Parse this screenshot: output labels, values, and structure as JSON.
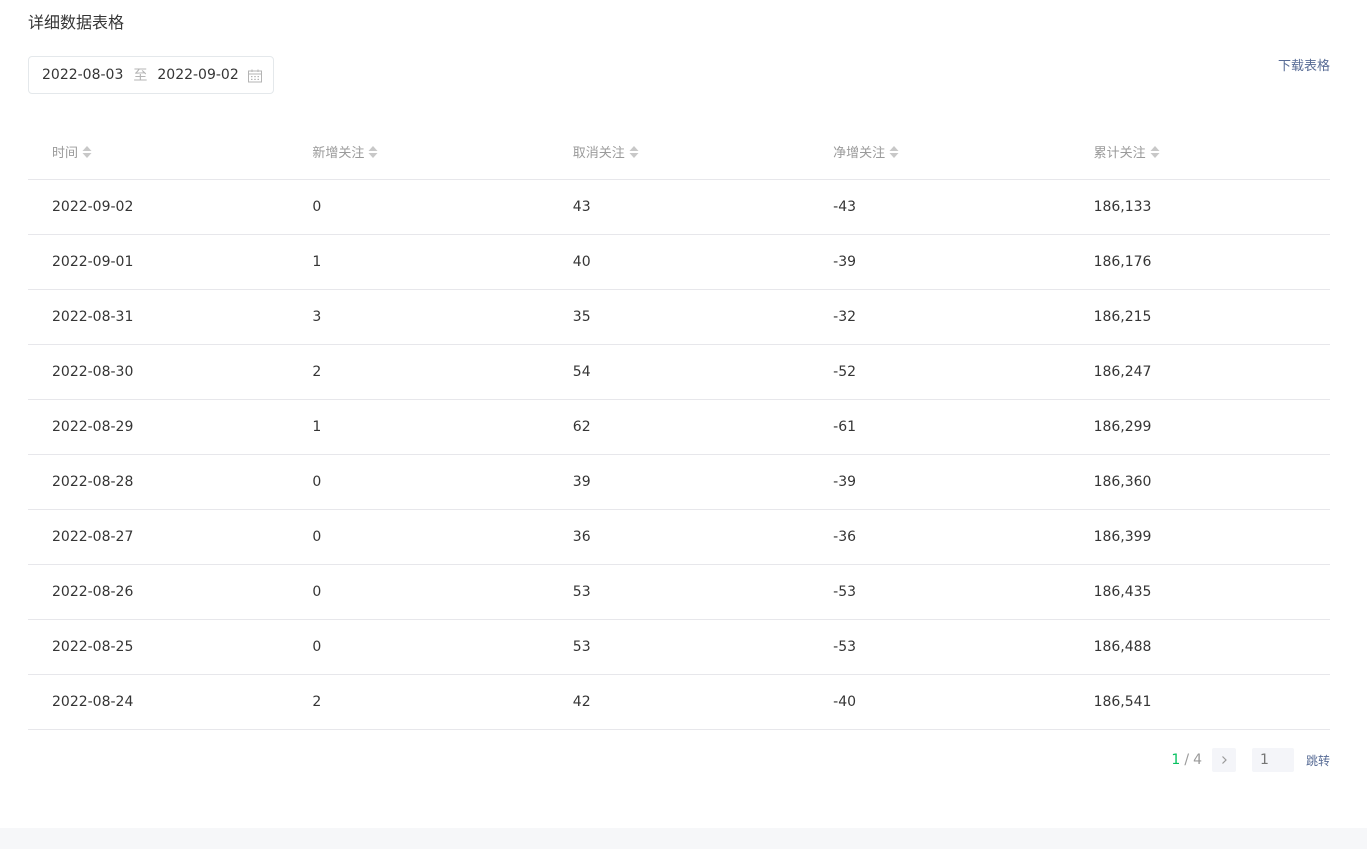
{
  "section": {
    "title": "详细数据表格"
  },
  "date_range": {
    "start": "2022-08-03",
    "separator": "至",
    "end": "2022-09-02"
  },
  "download": {
    "label": "下载表格"
  },
  "table": {
    "columns": [
      "时间",
      "新增关注",
      "取消关注",
      "净增关注",
      "累计关注"
    ],
    "rows": [
      [
        "2022-09-02",
        "0",
        "43",
        "-43",
        "186,133"
      ],
      [
        "2022-09-01",
        "1",
        "40",
        "-39",
        "186,176"
      ],
      [
        "2022-08-31",
        "3",
        "35",
        "-32",
        "186,215"
      ],
      [
        "2022-08-30",
        "2",
        "54",
        "-52",
        "186,247"
      ],
      [
        "2022-08-29",
        "1",
        "62",
        "-61",
        "186,299"
      ],
      [
        "2022-08-28",
        "0",
        "39",
        "-39",
        "186,360"
      ],
      [
        "2022-08-27",
        "0",
        "36",
        "-36",
        "186,399"
      ],
      [
        "2022-08-26",
        "0",
        "53",
        "-53",
        "186,435"
      ],
      [
        "2022-08-25",
        "0",
        "53",
        "-53",
        "186,488"
      ],
      [
        "2022-08-24",
        "2",
        "42",
        "-40",
        "186,541"
      ]
    ]
  },
  "pagination": {
    "current": "1",
    "separator": "/",
    "total": "4",
    "jump_placeholder": "1",
    "jump_label": "跳转"
  },
  "colors": {
    "accent_green": "#07c160",
    "link_blue": "#576b95",
    "muted_text": "#9a9a9a",
    "border": "#e7e7eb"
  },
  "icons": {
    "calendar": "calendar-icon",
    "sort": "sort-icon",
    "next": "chevron-right-icon"
  }
}
